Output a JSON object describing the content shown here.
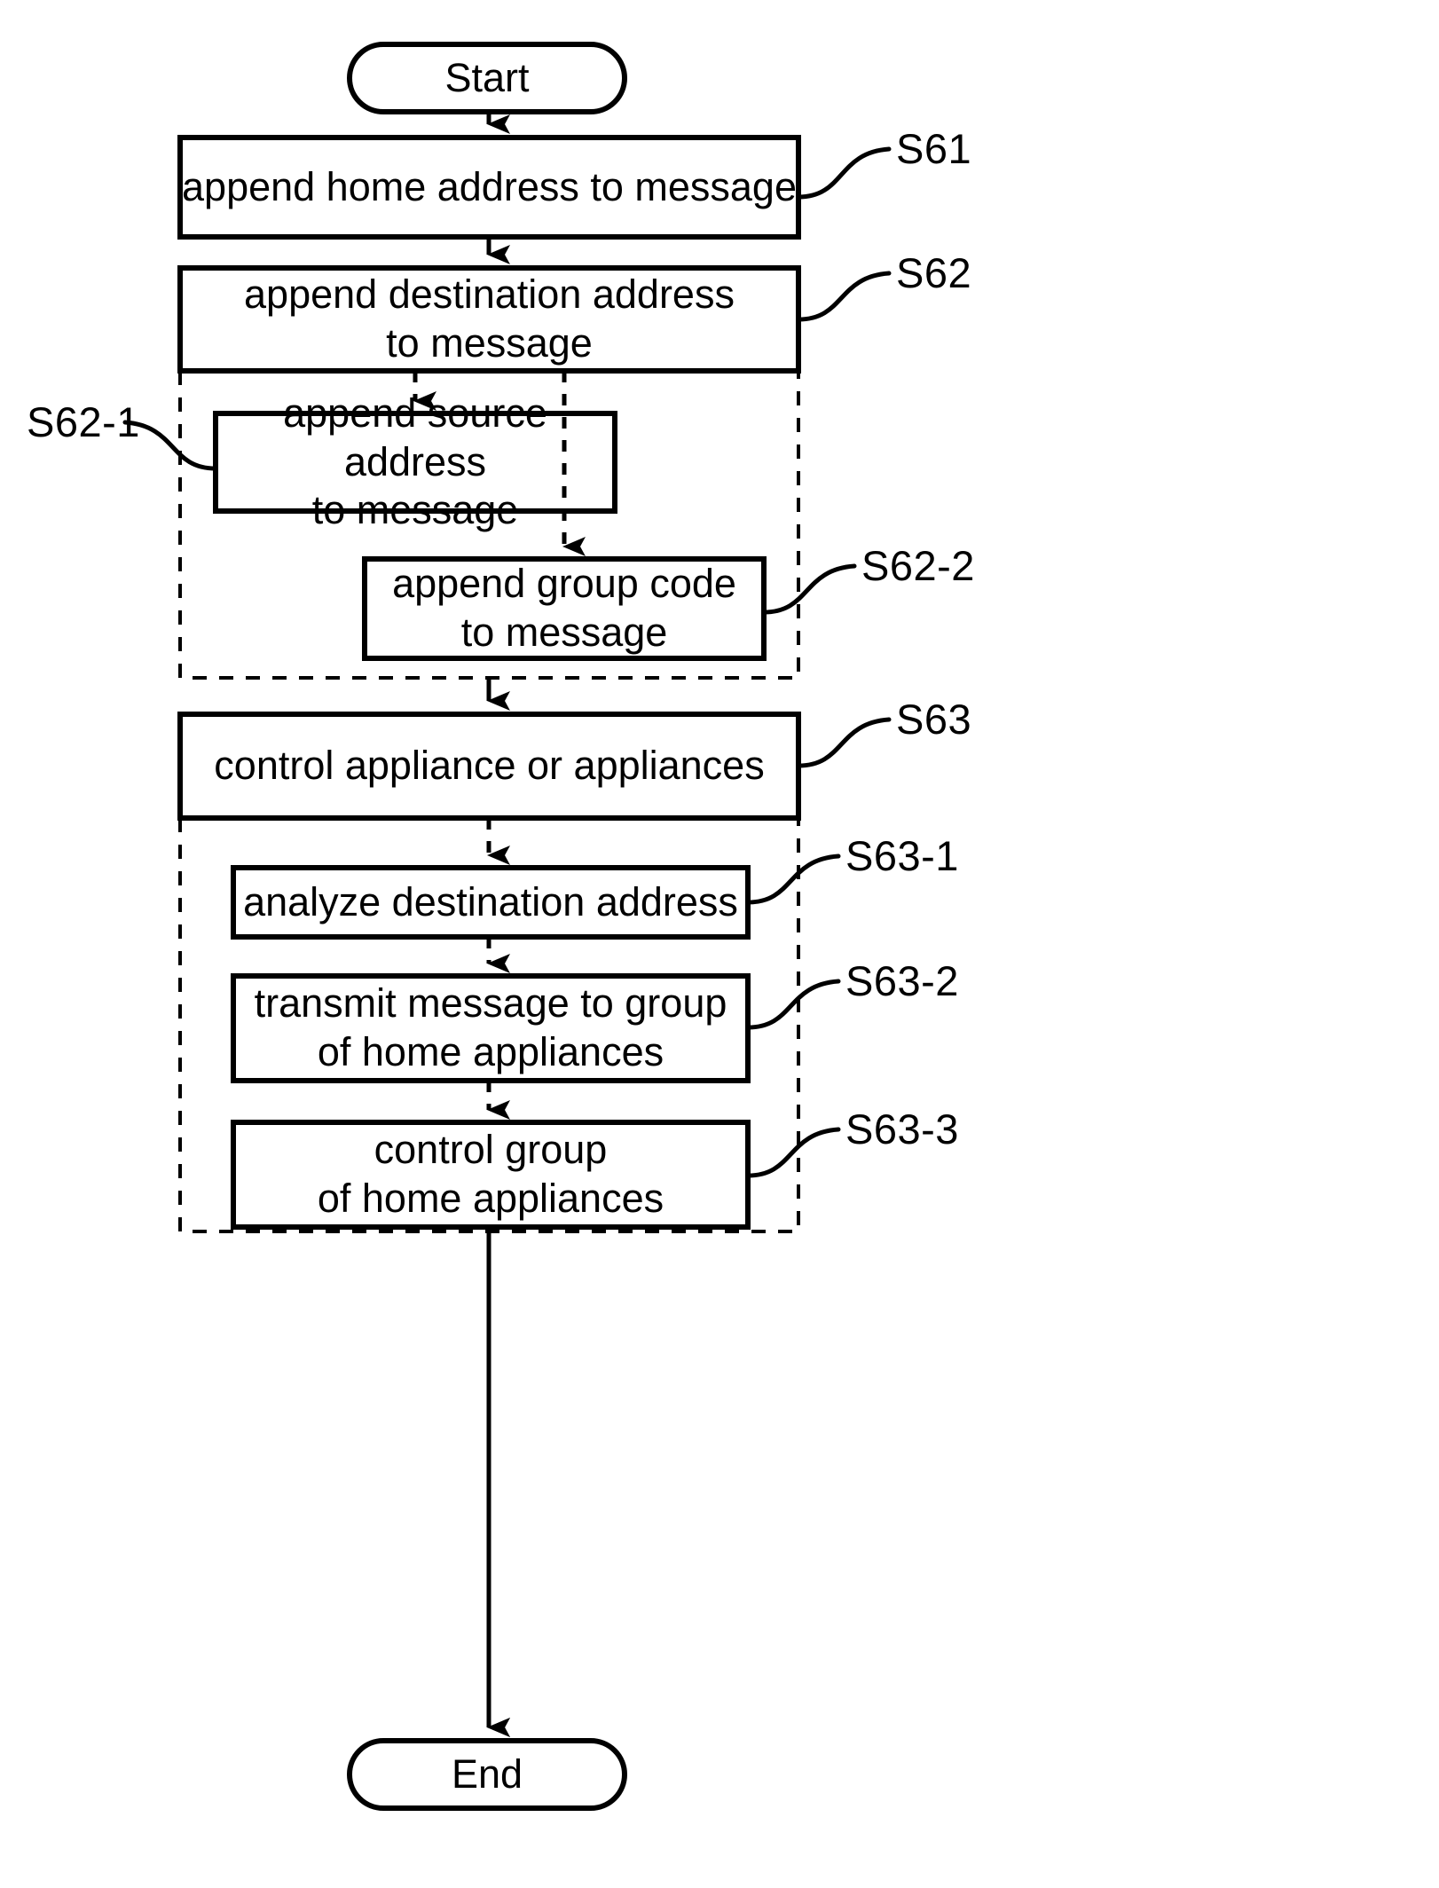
{
  "diagram": {
    "title": "flowchart",
    "ink_color": "#000000",
    "background_color": "#ffffff",
    "terminals": [
      {
        "id": "start",
        "label": "Start"
      },
      {
        "id": "end",
        "label": "End"
      }
    ],
    "steps": [
      {
        "id": "s61",
        "ref": "S61",
        "label": "append home address to message",
        "lines": [
          "append home address to message"
        ],
        "level": "main"
      },
      {
        "id": "s62",
        "ref": "S62",
        "label": "append destination address to message",
        "lines": [
          "append destination address",
          "to message"
        ],
        "level": "main"
      },
      {
        "id": "s62-1",
        "ref": "S62-1",
        "label": "append source address to message",
        "lines": [
          "append source address",
          "to message"
        ],
        "level": "sub"
      },
      {
        "id": "s62-2",
        "ref": "S62-2",
        "label": "append group code to message",
        "lines": [
          "append group code",
          "to message"
        ],
        "level": "sub"
      },
      {
        "id": "s63",
        "ref": "S63",
        "label": "control appliance or appliances",
        "lines": [
          "control appliance or appliances"
        ],
        "level": "main"
      },
      {
        "id": "s63-1",
        "ref": "S63-1",
        "label": "analyze destination address",
        "lines": [
          "analyze destination address"
        ],
        "level": "sub"
      },
      {
        "id": "s63-2",
        "ref": "S63-2",
        "label": "transmit message to group of home appliances",
        "lines": [
          "transmit message to group",
          "of home appliances"
        ],
        "level": "sub"
      },
      {
        "id": "s63-3",
        "ref": "S63-3",
        "label": "control group of home appliances",
        "lines": [
          "control group",
          "of home appliances"
        ],
        "level": "sub"
      }
    ],
    "groups": [
      {
        "id": "s62-group",
        "ref": "S62",
        "style": "dashed"
      },
      {
        "id": "s63-group",
        "ref": "S63",
        "style": "dashed"
      }
    ],
    "connectors": [
      {
        "from": "start",
        "to": "s61",
        "style": "solid"
      },
      {
        "from": "s61",
        "to": "s62",
        "style": "solid"
      },
      {
        "from": "s62",
        "to": "s62-1",
        "style": "dashed"
      },
      {
        "from": "s62",
        "to": "s62-2",
        "style": "dashed"
      },
      {
        "from": "s62-group",
        "to": "s63",
        "style": "solid"
      },
      {
        "from": "s63",
        "to": "s63-1",
        "style": "dashed"
      },
      {
        "from": "s63-1",
        "to": "s63-2",
        "style": "dashed"
      },
      {
        "from": "s63-2",
        "to": "s63-3",
        "style": "dashed"
      },
      {
        "from": "s63-group",
        "to": "end",
        "style": "solid"
      }
    ]
  }
}
